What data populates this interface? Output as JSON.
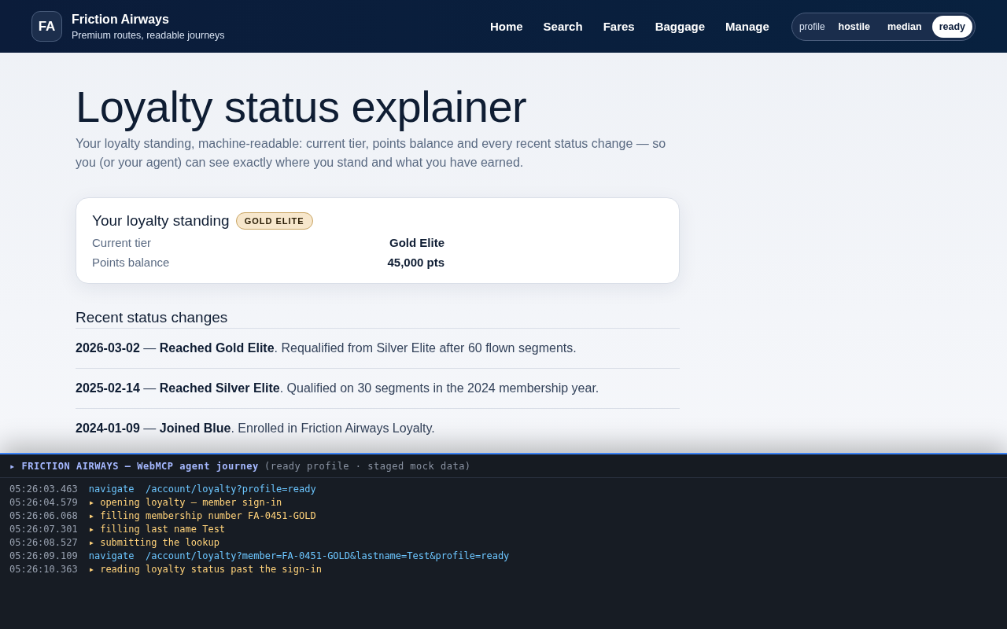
{
  "brand": {
    "logo": "FA",
    "name": "Friction Airways",
    "tagline": "Premium routes, readable journeys"
  },
  "nav": [
    {
      "label": "Home"
    },
    {
      "label": "Search"
    },
    {
      "label": "Fares"
    },
    {
      "label": "Baggage"
    },
    {
      "label": "Manage"
    }
  ],
  "profile_switch": {
    "label": "profile",
    "options": [
      {
        "label": "hostile",
        "selected": false
      },
      {
        "label": "median",
        "selected": false
      },
      {
        "label": "ready",
        "selected": true
      }
    ]
  },
  "page": {
    "title": "Loyalty status explainer",
    "intro": "Your loyalty standing, machine-readable: current tier, points balance and every recent status change — so you (or your agent) can see exactly where you stand and what you have earned."
  },
  "standing": {
    "title": "Your loyalty standing",
    "badge": "GOLD ELITE",
    "rows": [
      {
        "label": "Current tier",
        "value": "Gold Elite"
      },
      {
        "label": "Points balance",
        "value": "45,000 pts"
      }
    ]
  },
  "changes": {
    "title": "Recent status changes",
    "items": [
      {
        "date": "2026-03-02",
        "text": "— **Reached Gold Elite**. Requalified from Silver Elite after 60 flown segments."
      },
      {
        "date": "2025-02-14",
        "text": "— **Reached Silver Elite**. Qualified on 30 segments in the 2024 membership year."
      },
      {
        "date": "2024-01-09",
        "text": "— **Joined Blue**. Enrolled in Friction Airways Loyalty."
      }
    ]
  },
  "agent_log": {
    "title": "▸ FRICTION AIRWAYS — WebMCP agent journey",
    "subtitle": "(ready profile · staged mock data)",
    "entries": [
      {
        "time": "05:26:03.463",
        "kind": "navigate",
        "text": "navigate  /account/loyalty?profile=ready"
      },
      {
        "time": "05:26:04.579",
        "kind": "step",
        "text": "▸ opening loyalty — member sign-in"
      },
      {
        "time": "05:26:06.068",
        "kind": "step",
        "text": "▸ filling membership number FA-0451-GOLD"
      },
      {
        "time": "05:26:07.301",
        "kind": "step",
        "text": "▸ filling last name Test"
      },
      {
        "time": "05:26:08.527",
        "kind": "step",
        "text": "▸ submitting the lookup"
      },
      {
        "time": "05:26:09.109",
        "kind": "navigate",
        "text": "navigate  /account/loyalty?member=FA-0451-GOLD&lastname=Test&profile=ready"
      },
      {
        "time": "05:26:10.363",
        "kind": "step",
        "text": "▸ reading loyalty status past the sign-in"
      }
    ]
  }
}
